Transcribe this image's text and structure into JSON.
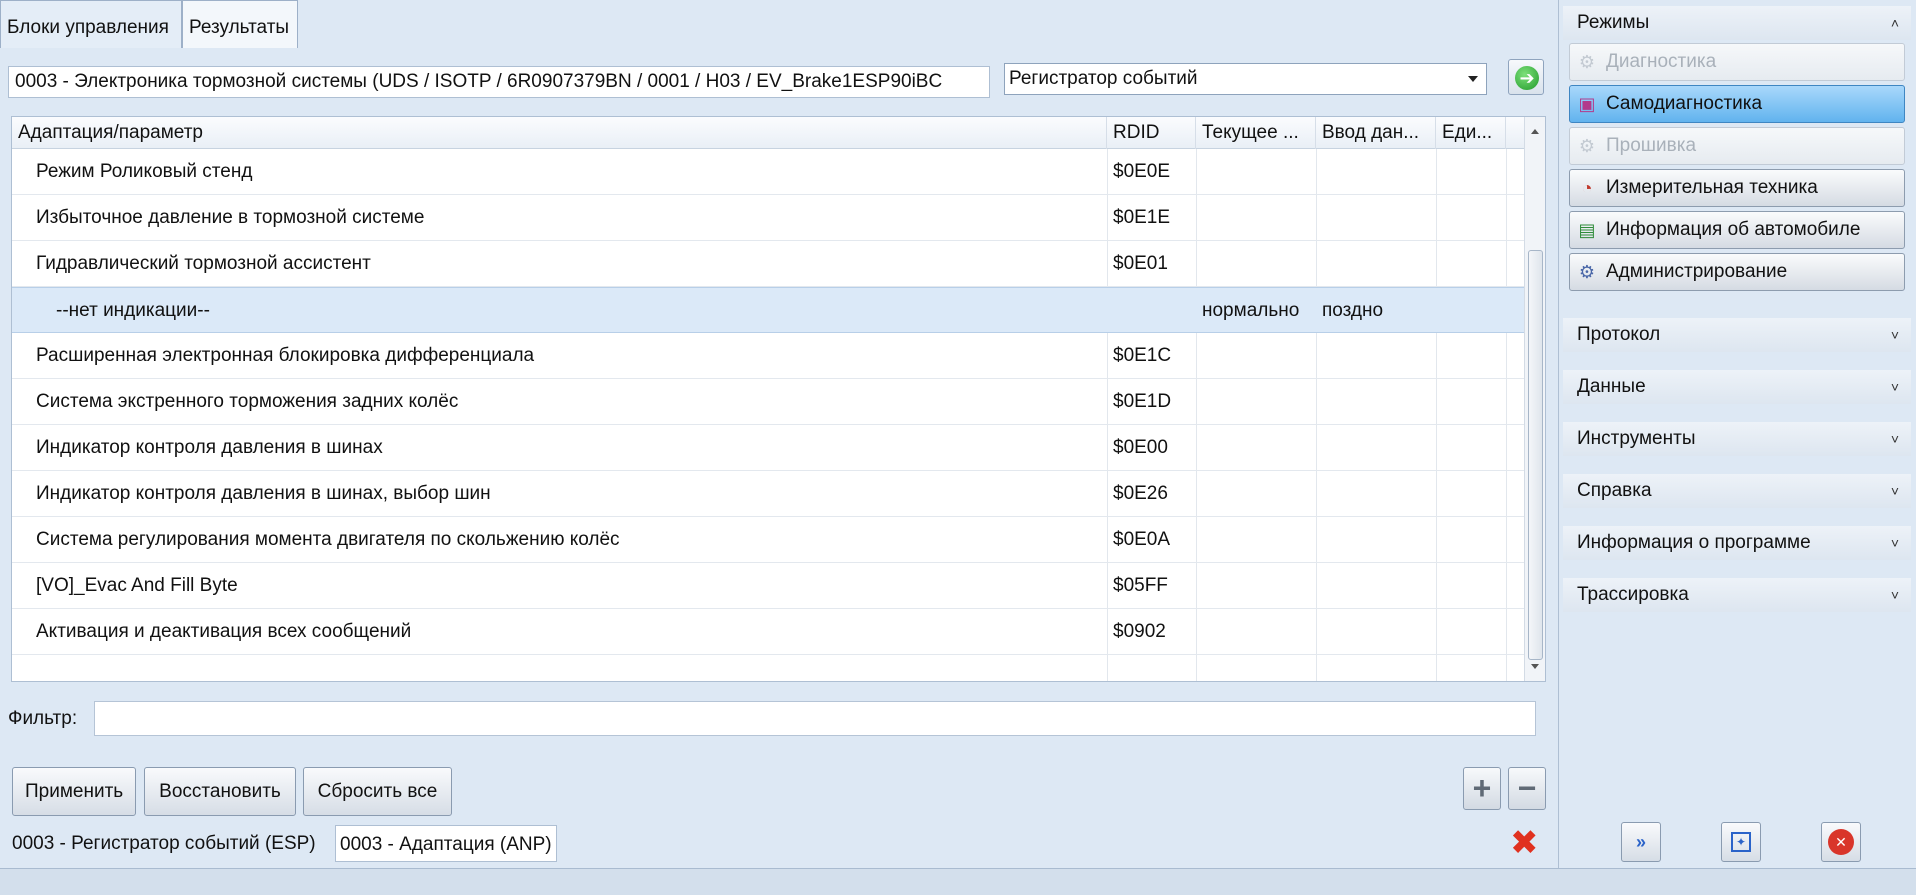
{
  "tabs": {
    "units": "Блоки управления",
    "results": "Результаты"
  },
  "module": "0003 - Электроника тормозной системы  (UDS / ISOTP / 6R0907379BN / 0001 / H03 / EV_Brake1ESP90iBC",
  "mode_select": {
    "value": "Регистратор событий"
  },
  "table": {
    "headers": [
      "Адаптация/параметр",
      "RDID",
      "Текущее ...",
      "Ввод дан...",
      "Еди..."
    ],
    "rows": [
      {
        "param": "Режим Роликовый стенд",
        "rdid": "$0E0E",
        "current": "",
        "input": "",
        "unit": ""
      },
      {
        "param": "Избыточное давление в тормозной системе",
        "rdid": "$0E1E",
        "current": "",
        "input": "",
        "unit": ""
      },
      {
        "param": "Гидравлический тормозной ассистент",
        "rdid": "$0E01",
        "current": "",
        "input": "",
        "unit": ""
      },
      {
        "param": "--нет индикации--",
        "rdid": "",
        "current": "нормально",
        "input": "поздно",
        "unit": ""
      },
      {
        "param": "Расширенная электронная блокировка дифференциала",
        "rdid": "$0E1C",
        "current": "",
        "input": "",
        "unit": ""
      },
      {
        "param": "Система экстренного торможения задних колёс",
        "rdid": "$0E1D",
        "current": "",
        "input": "",
        "unit": ""
      },
      {
        "param": "Индикатор контроля давления в шинах",
        "rdid": "$0E00",
        "current": "",
        "input": "",
        "unit": ""
      },
      {
        "param": "Индикатор контроля давления в шинах, выбор шин",
        "rdid": "$0E26",
        "current": "",
        "input": "",
        "unit": ""
      },
      {
        "param": "Система регулирования момента двигателя по скольжению колёс",
        "rdid": "$0E0A",
        "current": "",
        "input": "",
        "unit": ""
      },
      {
        "param": "[VO]_Evac And Fill Byte",
        "rdid": "$05FF",
        "current": "",
        "input": "",
        "unit": ""
      },
      {
        "param": "Активация и деактивация всех сообщений",
        "rdid": "$0902",
        "current": "",
        "input": "",
        "unit": ""
      }
    ]
  },
  "filter": {
    "label": "Фильтр:",
    "value": ""
  },
  "buttons": {
    "apply": "Применить",
    "restore": "Восстановить",
    "reset_all": "Сбросить все",
    "add": "+",
    "remove": "−"
  },
  "bottom_tabs": [
    "0003 - Регистратор событий (ESP)",
    "0003 - Адаптация (ANP)"
  ],
  "right_panel": {
    "modes_title": "Режимы",
    "modes": [
      "Диагностика",
      "Самодиагностика",
      "Прошивка",
      "Измерительная техника",
      "Информация об автомобиле",
      "Администрирование"
    ],
    "sections": [
      "Протокол",
      "Данные",
      "Инструменты",
      "Справка",
      "Информация о программе",
      "Трассировка"
    ]
  },
  "colors": {
    "selected_mode": "#61b3ee",
    "close_red": "#e0311f",
    "go_green": "#219a2a"
  }
}
